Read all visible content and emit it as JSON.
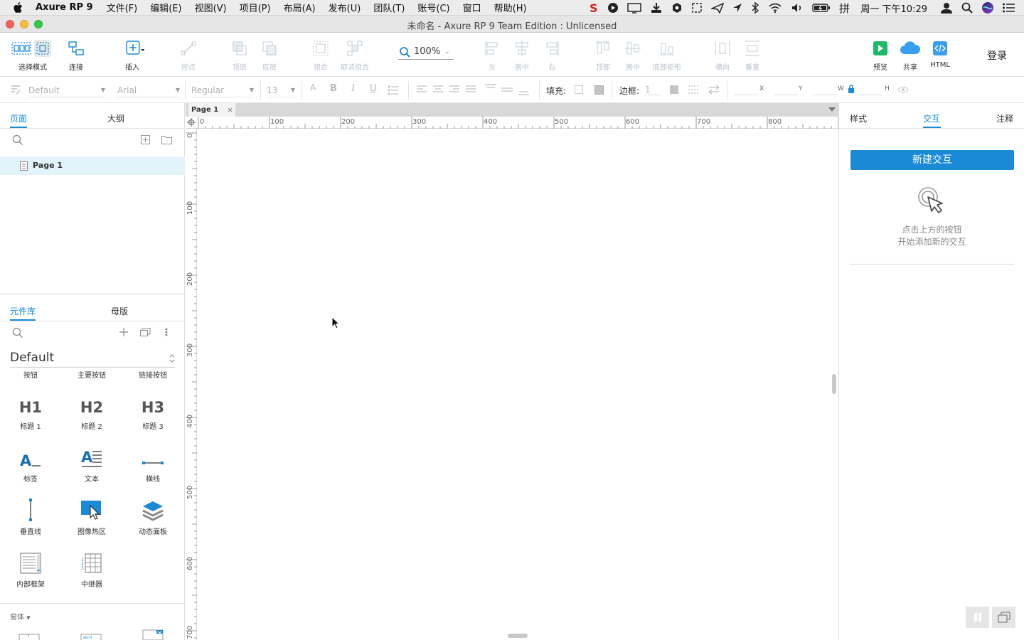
{
  "menubar": {
    "app_name": "Axure RP 9",
    "items": [
      "文件(F)",
      "编辑(E)",
      "视图(V)",
      "项目(P)",
      "布局(A)",
      "发布(U)",
      "团队(T)",
      "账号(C)",
      "窗口",
      "帮助(H)"
    ],
    "clock": "周一 下午10:29"
  },
  "window": {
    "title": "未命名 - Axure RP 9 Team Edition : Unlicensed"
  },
  "toolbar": {
    "select_mode": "选择模式",
    "connect": "连接",
    "insert": "插入",
    "points": "控点",
    "top": "顶层",
    "bottom": "底层",
    "group": "组合",
    "ungroup": "取消组合",
    "zoom": "100%",
    "align_left": "左",
    "align_center": "居中",
    "align_right": "右",
    "align_top": "顶部",
    "align_middle": "居中",
    "align_bottom": "底部矩形",
    "distribute_h": "横向",
    "distribute_v": "垂直",
    "preview": "预览",
    "share": "共享",
    "html": "HTML",
    "login": "登录"
  },
  "format": {
    "style": "Default",
    "font": "Arial",
    "weight": "Regular",
    "size": "13",
    "fill_label": "填充:",
    "border_label": "边框:",
    "border_width": "1",
    "x_label": "X",
    "y_label": "Y",
    "w_label": "W",
    "h_label": "H"
  },
  "pages_panel": {
    "tab_pages": "页面",
    "tab_outline": "大纲",
    "pages": [
      "Page 1"
    ]
  },
  "library_panel": {
    "tab_library": "元件库",
    "tab_masters": "母版",
    "library_name": "Default",
    "items": [
      {
        "label": "按钮",
        "icon": "button-icon"
      },
      {
        "label": "主要按钮",
        "icon": "primary-button-icon"
      },
      {
        "label": "链接按钮",
        "icon": "link-button-icon"
      },
      {
        "label": "标题 1",
        "icon": "heading-1-icon"
      },
      {
        "label": "标题 2",
        "icon": "heading-2-icon"
      },
      {
        "label": "标题 3",
        "icon": "heading-3-icon"
      },
      {
        "label": "标签",
        "icon": "label-icon"
      },
      {
        "label": "文本",
        "icon": "text-paragraph-icon"
      },
      {
        "label": "横线",
        "icon": "horizontal-line-icon"
      },
      {
        "label": "垂直线",
        "icon": "vertical-line-icon"
      },
      {
        "label": "图像热区",
        "icon": "hotspot-icon"
      },
      {
        "label": "动态面板",
        "icon": "dynamic-panel-icon"
      },
      {
        "label": "内部框架",
        "icon": "inline-frame-icon"
      },
      {
        "label": "中继器",
        "icon": "repeater-icon"
      }
    ],
    "section_forms": "窗体"
  },
  "canvas": {
    "tab": "Page 1",
    "h_ruler": [
      "0",
      "100",
      "200",
      "300",
      "400",
      "500",
      "600",
      "700",
      "800"
    ],
    "v_ruler": [
      "0",
      "100",
      "200",
      "300",
      "400",
      "500",
      "600",
      "700"
    ]
  },
  "right_panel": {
    "tab_style": "样式",
    "tab_interactions": "交互",
    "tab_notes": "注释",
    "new_interaction": "新建交互",
    "hint_line1": "点击上方的按钮",
    "hint_line2": "开始添加新的交互"
  },
  "colors": {
    "accent": "#1a8ad6",
    "selected_row": "#e3f3fa",
    "preview_green": "#1fb86a"
  }
}
